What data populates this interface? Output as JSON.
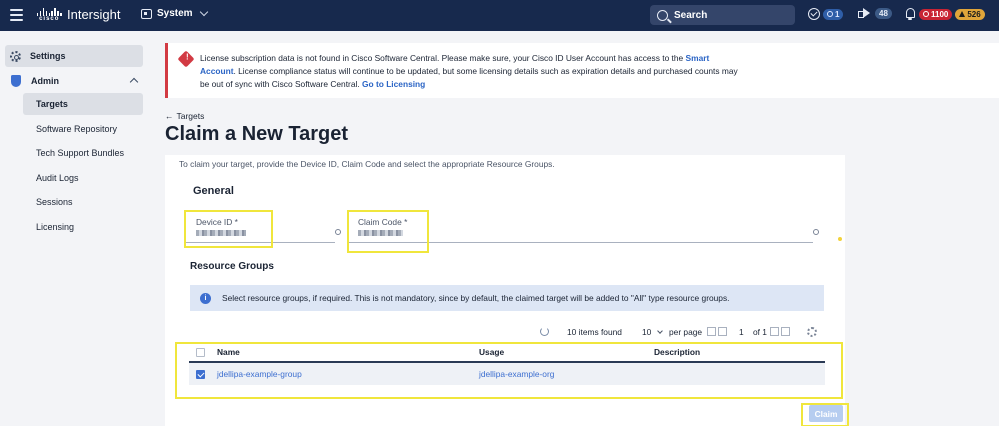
{
  "topbar": {
    "app_name": "Intersight",
    "logo_text": "cisco",
    "scope_label": "System",
    "search_label": "Search",
    "check_count": "1",
    "announce_count": "48",
    "critical_count": "1100",
    "warning_count": "526"
  },
  "sidebar": {
    "settings_label": "Settings",
    "admin_label": "Admin",
    "items": [
      {
        "label": "Targets",
        "active": true
      },
      {
        "label": "Software Repository"
      },
      {
        "label": "Tech Support Bundles"
      },
      {
        "label": "Audit Logs"
      },
      {
        "label": "Sessions"
      },
      {
        "label": "Licensing"
      }
    ]
  },
  "alert": {
    "text_part1": "License subscription data is not found in Cisco Software Central. Please make sure, your Cisco ID User Account has access to the ",
    "link_account": "Smart Account",
    "text_part2": ". License compliance status will continue to be updated, but some licensing details such as expiration details and purchased counts may be out of sync with Cisco Software Central. ",
    "link_go": "Go to Licensing"
  },
  "page": {
    "back_label": "Targets",
    "title": "Claim a New Target",
    "intro": "To claim your target, provide the Device ID, Claim Code and select the appropriate Resource Groups."
  },
  "form": {
    "general_heading": "General",
    "device_id_label": "Device ID *",
    "claim_code_label": "Claim Code *",
    "rg_heading": "Resource Groups",
    "info_text": "Select resource groups, if required. This is not mandatory, since by default, the claimed target will be added to \"All\" type resource groups."
  },
  "table": {
    "items_found": "10 items found",
    "per_page_value": "10",
    "per_page_label": "per page",
    "page_current": "1",
    "page_total": "of 1",
    "columns": [
      "Name",
      "Usage",
      "Description"
    ],
    "rows": [
      {
        "name": "jdellipa-example-group",
        "usage": "jdellipa-example-org",
        "description": ""
      }
    ]
  },
  "actions": {
    "claim_label": "Claim"
  },
  "colors": {
    "topbar": "#17294d",
    "accent": "#3d6fd0",
    "alert": "#d23a43",
    "highlight": "#f0e63c"
  }
}
